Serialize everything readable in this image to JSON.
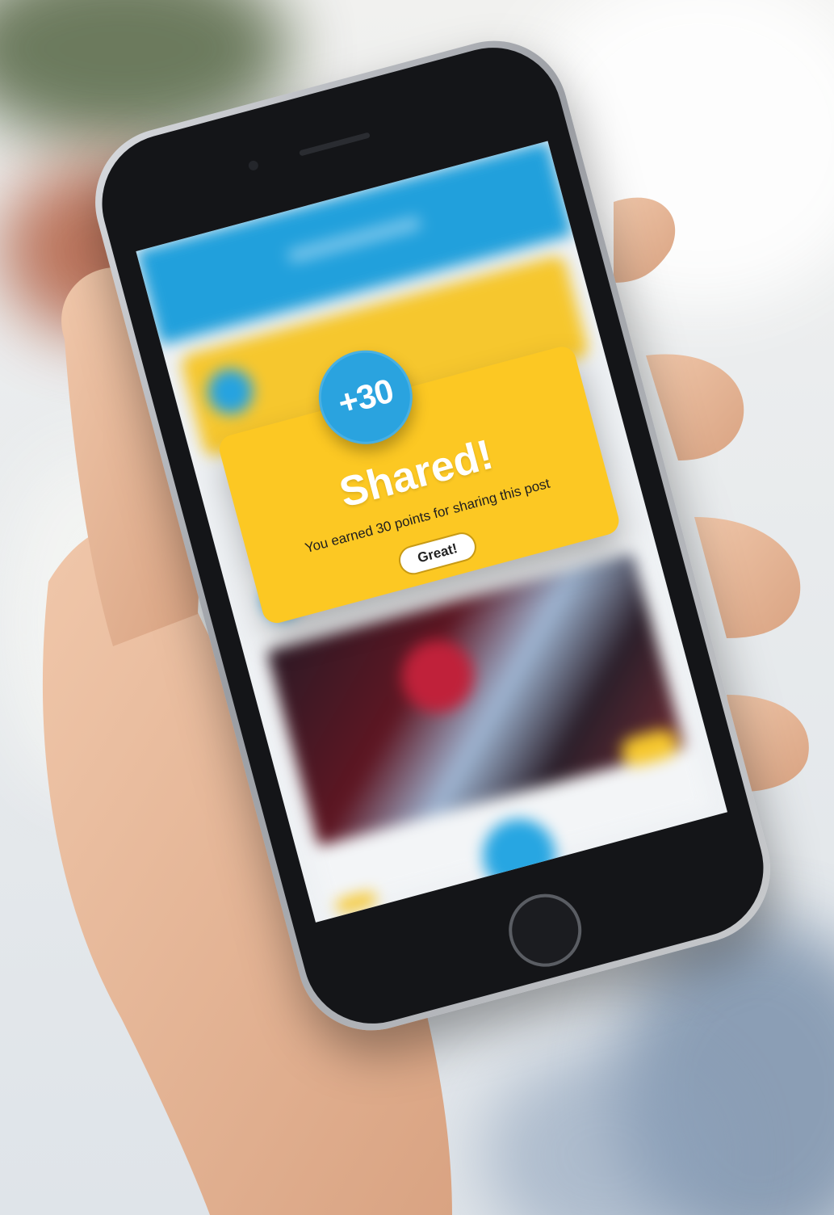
{
  "popup": {
    "badge": "+30",
    "title": "Shared!",
    "message": "You earned 30 points for sharing this post",
    "button_label": "Great!"
  },
  "colors": {
    "app_blue": "#21a0dc",
    "popup_yellow": "#fcc823",
    "badge_blue": "#2aa3df"
  }
}
